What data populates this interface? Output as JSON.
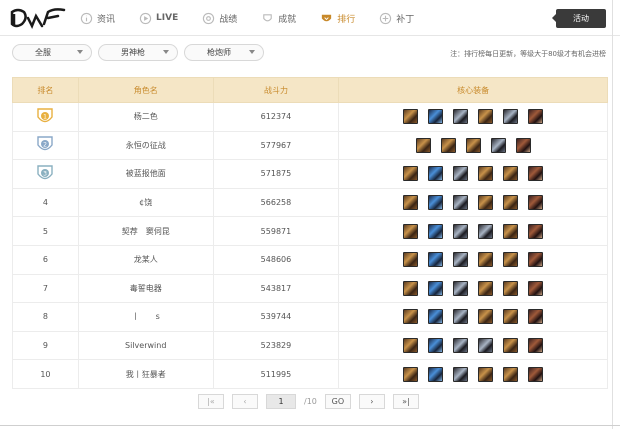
{
  "nav": {
    "logo": "DNF",
    "items": [
      {
        "label": "资讯",
        "icon": "info-icon"
      },
      {
        "label": "LIVE",
        "icon": "live-icon"
      },
      {
        "label": "战绩",
        "icon": "record-icon"
      },
      {
        "label": "成就",
        "icon": "achievement-icon"
      },
      {
        "label": "排行",
        "icon": "ranking-icon"
      },
      {
        "label": "补丁",
        "icon": "patch-icon"
      }
    ],
    "active": "排行",
    "activity_label": "活动"
  },
  "filters": {
    "server": "全服",
    "class": "男神枪",
    "subclass": "枪炮师",
    "note": "注：排行榜每日更新，等级大于80级才有机会进榜"
  },
  "table": {
    "headers": [
      "排名",
      "角色名",
      "战斗力",
      "核心装备"
    ],
    "rows": [
      {
        "rank": "1",
        "name": "杨二色",
        "power": "612374",
        "gear": [
          "bronze",
          "blue",
          "steel",
          "bronze",
          "steel",
          "dark"
        ]
      },
      {
        "rank": "2",
        "name": "永恒の征战",
        "power": "577967",
        "gear": [
          "bronze",
          "bronze",
          "bronze",
          "steel",
          "dark"
        ]
      },
      {
        "rank": "3",
        "name": "被蓝报他面",
        "power": "571875",
        "gear": [
          "bronze",
          "blue",
          "steel",
          "bronze",
          "bronze",
          "dark"
        ]
      },
      {
        "rank": "4",
        "name": "¢饶",
        "power": "566258",
        "gear": [
          "bronze",
          "blue",
          "steel",
          "bronze",
          "bronze",
          "dark"
        ]
      },
      {
        "rank": "5",
        "name": "契荐　窦伺昆",
        "power": "559871",
        "gear": [
          "bronze",
          "blue",
          "steel",
          "steel",
          "bronze",
          "dark"
        ]
      },
      {
        "rank": "6",
        "name": "龙某人",
        "power": "548606",
        "gear": [
          "bronze",
          "blue",
          "steel",
          "bronze",
          "bronze",
          "dark"
        ]
      },
      {
        "rank": "7",
        "name": "毒誓电器",
        "power": "543817",
        "gear": [
          "bronze",
          "blue",
          "steel",
          "bronze",
          "bronze",
          "dark"
        ]
      },
      {
        "rank": "8",
        "name": "丨　　s",
        "power": "539744",
        "gear": [
          "bronze",
          "blue",
          "steel",
          "bronze",
          "bronze",
          "dark"
        ]
      },
      {
        "rank": "9",
        "name": "Silverwind",
        "power": "523829",
        "gear": [
          "bronze",
          "blue",
          "steel",
          "steel",
          "bronze",
          "dark"
        ]
      },
      {
        "rank": "10",
        "name": "我丨狂暴者",
        "power": "511995",
        "gear": [
          "bronze",
          "blue",
          "steel",
          "bronze",
          "bronze",
          "dark"
        ]
      }
    ]
  },
  "pager": {
    "first": "|«",
    "prev": "‹",
    "current": "1",
    "total": "/10",
    "go": "GO",
    "next": "›",
    "last": "»|"
  },
  "colors": {
    "accent": "#c8892a",
    "header_bg": "#f5e6c6",
    "activity_bg": "#3a3a3a"
  }
}
